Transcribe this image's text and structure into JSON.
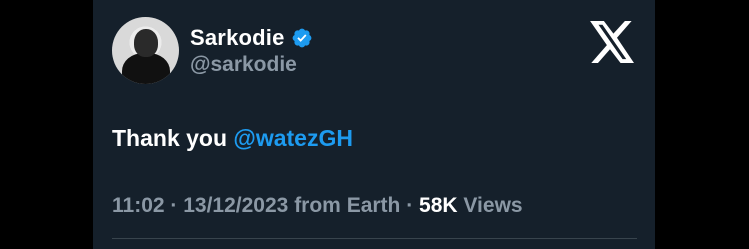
{
  "author": {
    "display_name": "Sarkodie",
    "handle": "@sarkodie",
    "verified": true,
    "verified_color": "#1d9bf0",
    "avatar_icon": "profile-photo"
  },
  "platform_logo": "x-logo-icon",
  "tweet": {
    "text_prefix": "Thank you ",
    "mention": "@watezGH"
  },
  "meta": {
    "time": "11:02",
    "date": "13/12/2023",
    "source": "from Earth",
    "separator": " · ",
    "views_count": "58K",
    "views_label": "Views"
  },
  "colors": {
    "background": "#15202b",
    "text_primary": "#ffffff",
    "text_secondary": "#8b98a5",
    "accent": "#1d9bf0"
  }
}
